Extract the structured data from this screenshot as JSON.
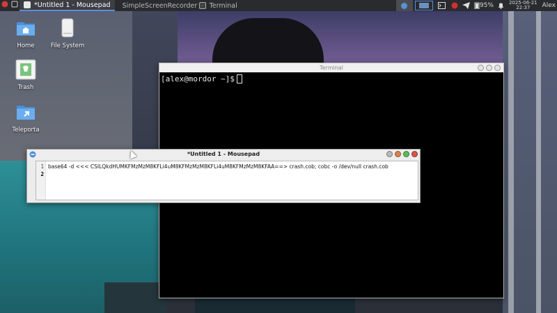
{
  "panel": {
    "tasks": [
      {
        "label": "*Untitled 1 - Mousepad",
        "active": true,
        "icon": "mousepad-icon"
      },
      {
        "label": "SimpleScreenRecorder",
        "active": false,
        "icon": "recorder-icon"
      },
      {
        "label": "Terminal",
        "active": false,
        "icon": "terminal-icon"
      }
    ],
    "battery": "95%",
    "clock_date": "2025-06-21",
    "clock_time": "22:37",
    "user": "Alex"
  },
  "desktop_icons": [
    {
      "label": "Home",
      "icon": "home-folder-icon"
    },
    {
      "label": "File System",
      "icon": "drive-icon"
    },
    {
      "label": "Trash",
      "icon": "trash-icon"
    },
    {
      "label": "Teleporta",
      "icon": "teleporta-folder-icon"
    }
  ],
  "terminal": {
    "title": "Terminal",
    "prompt": "[alex@mordor ~]$"
  },
  "mousepad": {
    "title": "*Untitled 1 - Mousepad",
    "line_numbers": [
      "1",
      "2"
    ],
    "lines": [
      "base64 -d <<< CSILQkdHUMKFMzMzM8KFLi4uM8KFMzMzM8KFLi4uM8KFMzMzM8KFAA==> crash.cob;  cobc -o /dev/null crash.cob",
      ""
    ]
  },
  "colors": {
    "panel_bg": "#2a2b2f",
    "active_accent": "#5b8fd6",
    "close_red": "#d9534f",
    "maximize_green": "#5cb85c"
  }
}
